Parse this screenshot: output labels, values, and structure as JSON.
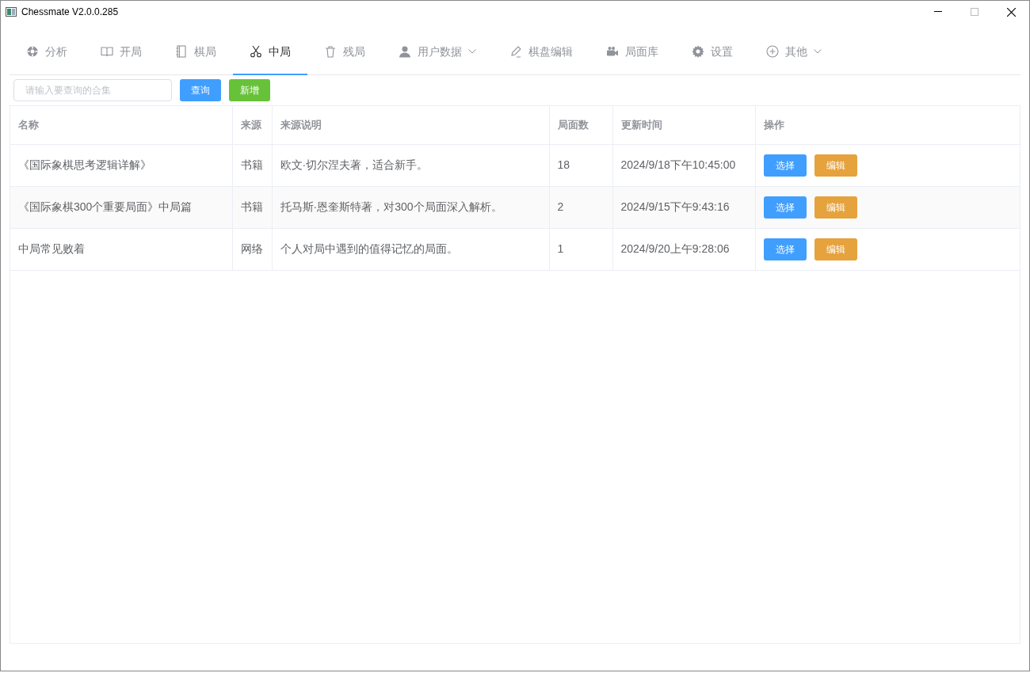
{
  "window": {
    "title": "Chessmate V2.0.0.285"
  },
  "tabs": [
    {
      "label": "分析",
      "selected": false,
      "dropdown": false
    },
    {
      "label": "开局",
      "selected": false,
      "dropdown": false
    },
    {
      "label": "棋局",
      "selected": false,
      "dropdown": false
    },
    {
      "label": "中局",
      "selected": true,
      "dropdown": false
    },
    {
      "label": "残局",
      "selected": false,
      "dropdown": false
    },
    {
      "label": "用户数据",
      "selected": false,
      "dropdown": true
    },
    {
      "label": "棋盘编辑",
      "selected": false,
      "dropdown": false
    },
    {
      "label": "局面库",
      "selected": false,
      "dropdown": false
    },
    {
      "label": "设置",
      "selected": false,
      "dropdown": false
    },
    {
      "label": "其他",
      "selected": false,
      "dropdown": true
    }
  ],
  "search": {
    "placeholder": "请输入要查询的合集"
  },
  "toolbar_buttons": [
    {
      "label": "查询",
      "kind": "primary"
    },
    {
      "label": "新增",
      "kind": "success"
    }
  ],
  "table": {
    "columns": [
      "名称",
      "来源",
      "来源说明",
      "局面数",
      "更新时间",
      "操作"
    ],
    "rows": [
      {
        "name": "《国际象棋思考逻辑详解》",
        "source": "书籍",
        "description": "欧文·切尔涅夫著，适合新手。",
        "positions": "18",
        "updated": "2024/9/18下午10:45:00",
        "actions": [
          {
            "label": "选择",
            "kind": "primary"
          },
          {
            "label": "编辑",
            "kind": "warning"
          }
        ]
      },
      {
        "name": "《国际象棋300个重要局面》中局篇",
        "source": "书籍",
        "description": "托马斯·恩奎斯特著，对300个局面深入解析。",
        "positions": "2",
        "updated": "2024/9/15下午9:43:16",
        "actions": [
          {
            "label": "选择",
            "kind": "primary"
          },
          {
            "label": "编辑",
            "kind": "warning"
          }
        ]
      },
      {
        "name": "中局常见败着",
        "source": "网络",
        "description": "个人对局中遇到的值得记忆的局面。",
        "positions": "1",
        "updated": "2024/9/20上午9:28:06",
        "actions": [
          {
            "label": "选择",
            "kind": "primary"
          },
          {
            "label": "编辑",
            "kind": "warning"
          }
        ]
      }
    ]
  }
}
